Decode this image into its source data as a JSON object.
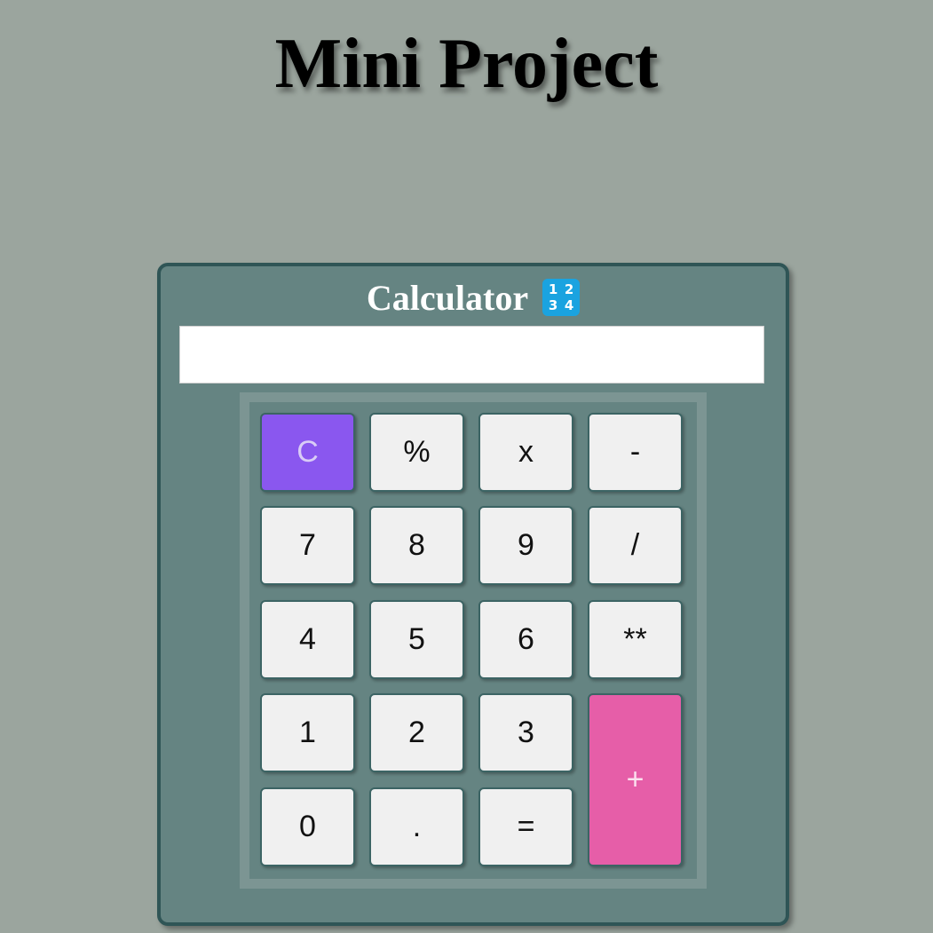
{
  "page": {
    "title": "Mini Project"
  },
  "calculator": {
    "title": "Calculator",
    "icon": "input-numbers-icon",
    "icon_digits": [
      "1",
      "2",
      "3",
      "4"
    ],
    "display": {
      "value": "",
      "placeholder": ""
    },
    "keys": {
      "clear": "C",
      "percent": "%",
      "multiply": "x",
      "subtract": "-",
      "seven": "7",
      "eight": "8",
      "nine": "9",
      "divide": "/",
      "four": "4",
      "five": "5",
      "six": "6",
      "power": "**",
      "one": "1",
      "two": "2",
      "three": "3",
      "add": "+",
      "zero": "0",
      "decimal": ".",
      "equals": "="
    }
  },
  "colors": {
    "page_background": "#9ba59e",
    "calculator_body": "#658482",
    "clear_key": "#8a57ef",
    "add_key": "#e65ea8",
    "key_face": "#f0f0f0"
  }
}
